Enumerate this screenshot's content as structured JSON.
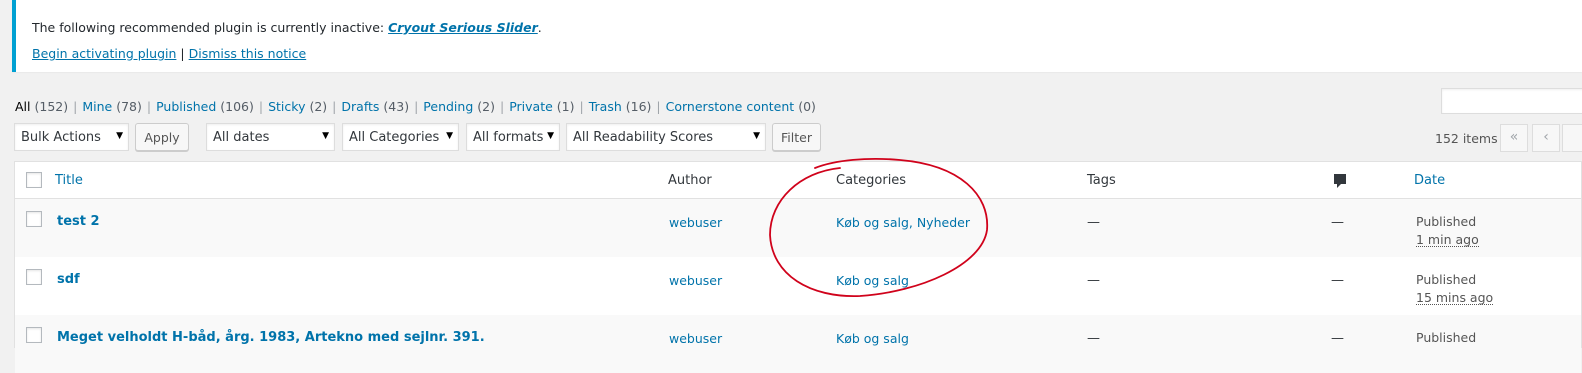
{
  "notice": {
    "message_prefix": "The following recommended plugin is currently inactive: ",
    "plugin_name": "Cryout Serious Slider",
    "message_suffix": ".",
    "activate_label": "Begin activating plugin",
    "separator": "|",
    "dismiss_label": "Dismiss this notice"
  },
  "views": [
    {
      "label": "All",
      "count": "(152)"
    },
    {
      "label": "Mine",
      "count": "(78)"
    },
    {
      "label": "Published",
      "count": "(106)"
    },
    {
      "label": "Sticky",
      "count": "(2)"
    },
    {
      "label": "Drafts",
      "count": "(43)"
    },
    {
      "label": "Pending",
      "count": "(2)"
    },
    {
      "label": "Private",
      "count": "(1)"
    },
    {
      "label": "Trash",
      "count": "(16)"
    },
    {
      "label": "Cornerstone content",
      "count": "(0)"
    }
  ],
  "toolbar": {
    "bulk_actions": "Bulk Actions",
    "apply_label": "Apply",
    "dates": "All dates",
    "categories": "All Categories",
    "formats": "All formats",
    "readability": "All Readability Scores",
    "filter_label": "Filter",
    "items_count": "152 items",
    "first_page": "«",
    "prev_page": "‹"
  },
  "columns": {
    "title": "Title",
    "author": "Author",
    "categories": "Categories",
    "tags": "Tags",
    "date": "Date"
  },
  "rows": [
    {
      "title": "test 2",
      "author": "webuser",
      "categories": "Køb og salg, Nyheder",
      "tags": "—",
      "comments": "—",
      "status": "Published",
      "ago": "1 min ago"
    },
    {
      "title": "sdf",
      "author": "webuser",
      "categories": "Køb og salg",
      "tags": "—",
      "comments": "—",
      "status": "Published",
      "ago": "15 mins ago"
    },
    {
      "title": "Meget velholdt H-båd, årg. 1983, Artekno med sejlnr. 391.",
      "author": "webuser",
      "categories": "Køb og salg",
      "tags": "—",
      "comments": "—",
      "status": "Published",
      "ago": ""
    }
  ],
  "colors": {
    "link": "#0073aa",
    "notice_border": "#00a0d2",
    "annotation": "#d0021b"
  }
}
